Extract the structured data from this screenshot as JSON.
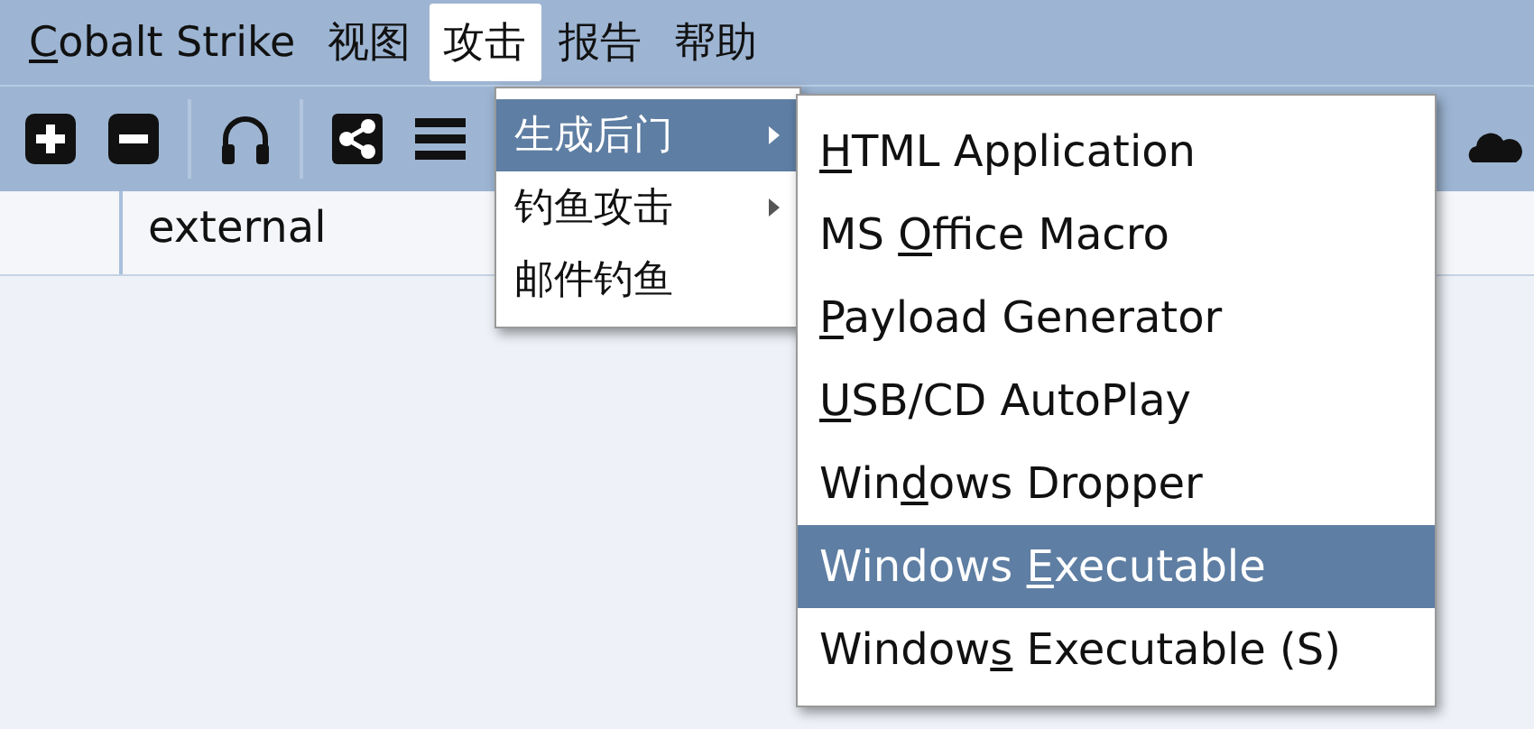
{
  "menubar": [
    {
      "key": "C",
      "post": "obalt Strike",
      "selected": false
    },
    {
      "pre": "视图",
      "selected": false
    },
    {
      "pre": "攻击",
      "selected": true
    },
    {
      "pre": "报告",
      "selected": false
    },
    {
      "pre": "帮助",
      "selected": false
    }
  ],
  "table": {
    "columns": [
      "external"
    ]
  },
  "menu": [
    {
      "label": "生成后门",
      "submenu": true,
      "selected": true
    },
    {
      "label": "钓鱼攻击",
      "submenu": true,
      "selected": false
    },
    {
      "label": "邮件钓鱼",
      "submenu": false,
      "selected": false
    }
  ],
  "submenu": [
    {
      "key": "H",
      "post": "TML Application",
      "selected": false
    },
    {
      "pre": "MS ",
      "key": "O",
      "post": "ffice Macro",
      "selected": false
    },
    {
      "key": "P",
      "post": "ayload Generator",
      "selected": false
    },
    {
      "key": "U",
      "post": "SB/CD AutoPlay",
      "selected": false
    },
    {
      "pre": "Win",
      "key": "d",
      "post": "ows Dropper",
      "selected": false
    },
    {
      "pre": "Windows ",
      "key": "E",
      "post": "xecutable",
      "selected": true
    },
    {
      "pre": "Window",
      "key": "s",
      "post": " Executable (S)",
      "selected": false
    }
  ]
}
